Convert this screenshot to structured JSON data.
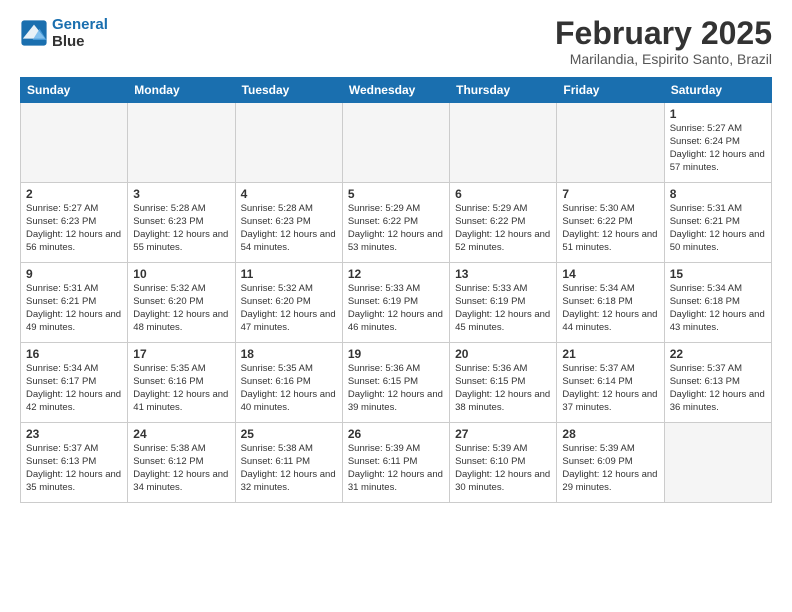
{
  "header": {
    "logo_line1": "General",
    "logo_line2": "Blue",
    "month_year": "February 2025",
    "location": "Marilandia, Espirito Santo, Brazil"
  },
  "days_of_week": [
    "Sunday",
    "Monday",
    "Tuesday",
    "Wednesday",
    "Thursday",
    "Friday",
    "Saturday"
  ],
  "weeks": [
    [
      {
        "day": "",
        "empty": true
      },
      {
        "day": "",
        "empty": true
      },
      {
        "day": "",
        "empty": true
      },
      {
        "day": "",
        "empty": true
      },
      {
        "day": "",
        "empty": true
      },
      {
        "day": "",
        "empty": true
      },
      {
        "day": "1",
        "sunrise": "5:27 AM",
        "sunset": "6:24 PM",
        "daylight": "12 hours and 57 minutes."
      }
    ],
    [
      {
        "day": "2",
        "sunrise": "5:27 AM",
        "sunset": "6:23 PM",
        "daylight": "12 hours and 56 minutes."
      },
      {
        "day": "3",
        "sunrise": "5:28 AM",
        "sunset": "6:23 PM",
        "daylight": "12 hours and 55 minutes."
      },
      {
        "day": "4",
        "sunrise": "5:28 AM",
        "sunset": "6:23 PM",
        "daylight": "12 hours and 54 minutes."
      },
      {
        "day": "5",
        "sunrise": "5:29 AM",
        "sunset": "6:22 PM",
        "daylight": "12 hours and 53 minutes."
      },
      {
        "day": "6",
        "sunrise": "5:29 AM",
        "sunset": "6:22 PM",
        "daylight": "12 hours and 52 minutes."
      },
      {
        "day": "7",
        "sunrise": "5:30 AM",
        "sunset": "6:22 PM",
        "daylight": "12 hours and 51 minutes."
      },
      {
        "day": "8",
        "sunrise": "5:31 AM",
        "sunset": "6:21 PM",
        "daylight": "12 hours and 50 minutes."
      }
    ],
    [
      {
        "day": "9",
        "sunrise": "5:31 AM",
        "sunset": "6:21 PM",
        "daylight": "12 hours and 49 minutes."
      },
      {
        "day": "10",
        "sunrise": "5:32 AM",
        "sunset": "6:20 PM",
        "daylight": "12 hours and 48 minutes."
      },
      {
        "day": "11",
        "sunrise": "5:32 AM",
        "sunset": "6:20 PM",
        "daylight": "12 hours and 47 minutes."
      },
      {
        "day": "12",
        "sunrise": "5:33 AM",
        "sunset": "6:19 PM",
        "daylight": "12 hours and 46 minutes."
      },
      {
        "day": "13",
        "sunrise": "5:33 AM",
        "sunset": "6:19 PM",
        "daylight": "12 hours and 45 minutes."
      },
      {
        "day": "14",
        "sunrise": "5:34 AM",
        "sunset": "6:18 PM",
        "daylight": "12 hours and 44 minutes."
      },
      {
        "day": "15",
        "sunrise": "5:34 AM",
        "sunset": "6:18 PM",
        "daylight": "12 hours and 43 minutes."
      }
    ],
    [
      {
        "day": "16",
        "sunrise": "5:34 AM",
        "sunset": "6:17 PM",
        "daylight": "12 hours and 42 minutes."
      },
      {
        "day": "17",
        "sunrise": "5:35 AM",
        "sunset": "6:16 PM",
        "daylight": "12 hours and 41 minutes."
      },
      {
        "day": "18",
        "sunrise": "5:35 AM",
        "sunset": "6:16 PM",
        "daylight": "12 hours and 40 minutes."
      },
      {
        "day": "19",
        "sunrise": "5:36 AM",
        "sunset": "6:15 PM",
        "daylight": "12 hours and 39 minutes."
      },
      {
        "day": "20",
        "sunrise": "5:36 AM",
        "sunset": "6:15 PM",
        "daylight": "12 hours and 38 minutes."
      },
      {
        "day": "21",
        "sunrise": "5:37 AM",
        "sunset": "6:14 PM",
        "daylight": "12 hours and 37 minutes."
      },
      {
        "day": "22",
        "sunrise": "5:37 AM",
        "sunset": "6:13 PM",
        "daylight": "12 hours and 36 minutes."
      }
    ],
    [
      {
        "day": "23",
        "sunrise": "5:37 AM",
        "sunset": "6:13 PM",
        "daylight": "12 hours and 35 minutes."
      },
      {
        "day": "24",
        "sunrise": "5:38 AM",
        "sunset": "6:12 PM",
        "daylight": "12 hours and 34 minutes."
      },
      {
        "day": "25",
        "sunrise": "5:38 AM",
        "sunset": "6:11 PM",
        "daylight": "12 hours and 32 minutes."
      },
      {
        "day": "26",
        "sunrise": "5:39 AM",
        "sunset": "6:11 PM",
        "daylight": "12 hours and 31 minutes."
      },
      {
        "day": "27",
        "sunrise": "5:39 AM",
        "sunset": "6:10 PM",
        "daylight": "12 hours and 30 minutes."
      },
      {
        "day": "28",
        "sunrise": "5:39 AM",
        "sunset": "6:09 PM",
        "daylight": "12 hours and 29 minutes."
      },
      {
        "day": "",
        "empty": true
      }
    ]
  ]
}
